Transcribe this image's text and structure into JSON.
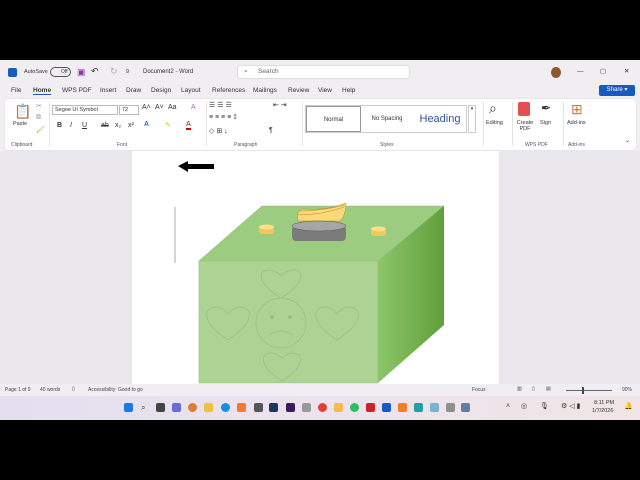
{
  "titlebar": {
    "autosave_label": "AutoSave",
    "autosave_state": "Off",
    "doc_title": "Document2 - Word",
    "search_placeholder": "Search",
    "minimize": "—",
    "restore": "▢",
    "close": "✕",
    "undo_count": "9"
  },
  "menu": {
    "items": [
      "File",
      "Home",
      "WPS PDF",
      "Insert",
      "Draw",
      "Design",
      "Layout",
      "References",
      "Mailings",
      "Review",
      "View",
      "Help"
    ],
    "active": "Home",
    "share": "Share"
  },
  "ribbon": {
    "clipboard": {
      "paste": "Paste",
      "group": "Clipboard"
    },
    "font": {
      "name": "Segoe UI Symbol",
      "size": "72",
      "bold": "B",
      "italic": "I",
      "underline": "U",
      "group": "Font"
    },
    "paragraph": {
      "group": "Paragraph",
      "pilcrow": "¶"
    },
    "styles": {
      "items": [
        "Normal",
        "No Spacing",
        "Heading"
      ],
      "group": "Styles"
    },
    "editing": {
      "label": "Editing"
    },
    "wps": {
      "create": "Create PDF",
      "sign": "Sign",
      "group": "WPS PDF"
    },
    "addins": {
      "label": "Add-ins",
      "group": "Add-ins"
    }
  },
  "status": {
    "page": "Page 1 of 9",
    "words": "40 words",
    "accessibility": "Accessibility: Good to go",
    "focus": "Focus",
    "zoom": "90%"
  },
  "taskbar": {
    "time": "8:11 PM",
    "date": "1/7/2026"
  },
  "colors": {
    "accent": "#185abd",
    "cube_front": "#a9d18e",
    "cube_top": "#93c47d",
    "cube_side": "#5fa03a"
  }
}
